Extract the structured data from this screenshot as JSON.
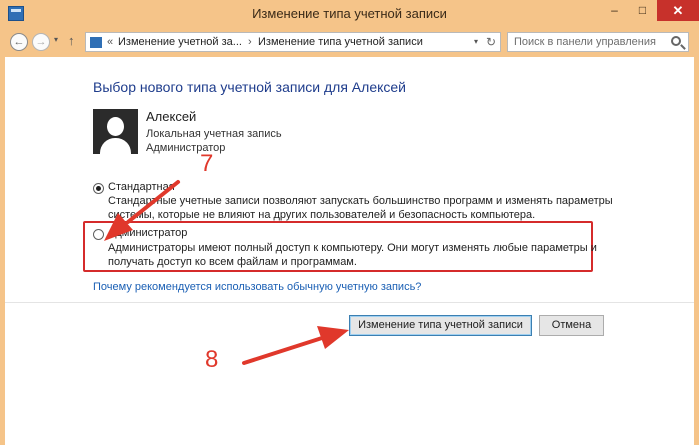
{
  "window": {
    "title": "Изменение типа учетной записи",
    "controls": {
      "minimize": "–",
      "maximize": "□",
      "close": "✕"
    }
  },
  "nav": {
    "back": "←",
    "forward": "→",
    "dropdown": "▾",
    "up": "↑",
    "address": {
      "prefix": "«",
      "segments": [
        "Изменение учетной за...",
        "Изменение типа учетной записи"
      ],
      "separator": "›",
      "dropdown": "▾",
      "refresh": "↻"
    },
    "search": {
      "placeholder": "Поиск в панели управления"
    }
  },
  "main": {
    "heading": "Выбор нового типа учетной записи для Алексей",
    "user": {
      "name": "Алексей",
      "lines": [
        "Локальная учетная запись",
        "Администратор"
      ]
    },
    "options": [
      {
        "label": "Стандартная",
        "selected": true,
        "desc_lines": [
          "Стандартные учетные записи позволяют запускать большинство программ и изменять параметры",
          "системы, которые не влияют на других пользователей и безопасность компьютера."
        ]
      },
      {
        "label": "Администратор",
        "selected": false,
        "desc_lines": [
          "Администраторы имеют полный доступ к компьютеру. Они могут изменять любые параметры и",
          "получать доступ ко всем файлам и программам."
        ]
      }
    ],
    "help_link": "Почему рекомендуется использовать обычную учетную запись?",
    "buttons": {
      "primary": "Изменение типа учетной записи",
      "cancel": "Отмена"
    }
  },
  "annotations": {
    "step_7": "7",
    "step_8": "8",
    "color": "#e0382b"
  }
}
